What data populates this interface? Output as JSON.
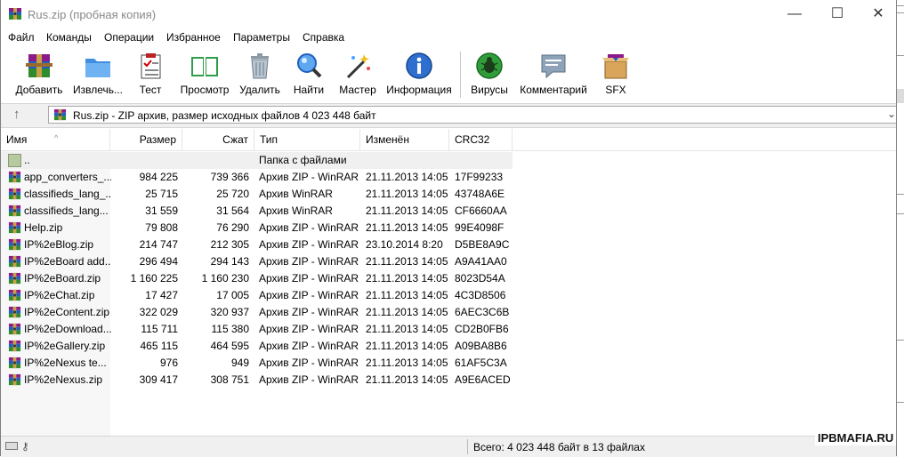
{
  "window": {
    "title": "Rus.zip (пробная копия)",
    "minimize_glyph": "—",
    "maximize_glyph": "☐",
    "close_glyph": "✕"
  },
  "menu": [
    "Файл",
    "Команды",
    "Операции",
    "Избранное",
    "Параметры",
    "Справка"
  ],
  "toolbar": [
    {
      "label": "Добавить",
      "icon": "add-archive-icon"
    },
    {
      "label": "Извлечь...",
      "icon": "extract-folder-icon"
    },
    {
      "label": "Тест",
      "icon": "test-clipboard-icon"
    },
    {
      "label": "Просмотр",
      "icon": "view-book-icon"
    },
    {
      "label": "Удалить",
      "icon": "trash-icon"
    },
    {
      "label": "Найти",
      "icon": "find-magnifier-icon"
    },
    {
      "label": "Мастер",
      "icon": "wizard-wand-icon"
    },
    {
      "label": "Информация",
      "icon": "info-icon"
    },
    {
      "label": "Вирусы",
      "icon": "virus-scan-icon"
    },
    {
      "label": "Комментарий",
      "icon": "comment-icon"
    },
    {
      "label": "SFX",
      "icon": "sfx-box-icon"
    }
  ],
  "address": {
    "up_glyph": "↑",
    "path": "Rus.zip - ZIP архив, размер исходных файлов 4 023 448 байт",
    "dropdown_glyph": "⌄"
  },
  "columns": [
    "Имя",
    "Размер",
    "Сжат",
    "Тип",
    "Изменён",
    "CRC32"
  ],
  "parent_row": {
    "name": "..",
    "type": "Папка с файлами"
  },
  "files": [
    {
      "name": "app_converters_...",
      "size": "984 225",
      "packed": "739 366",
      "type": "Архив ZIP - WinRAR",
      "modified": "21.11.2013 14:05",
      "crc": "17F99233"
    },
    {
      "name": "classifieds_lang_...",
      "size": "25 715",
      "packed": "25 720",
      "type": "Архив WinRAR",
      "modified": "21.11.2013 14:05",
      "crc": "43748A6E"
    },
    {
      "name": "classifieds_lang...",
      "size": "31 559",
      "packed": "31 564",
      "type": "Архив WinRAR",
      "modified": "21.11.2013 14:05",
      "crc": "CF6660AA"
    },
    {
      "name": "Help.zip",
      "size": "79 808",
      "packed": "76 290",
      "type": "Архив ZIP - WinRAR",
      "modified": "21.11.2013 14:05",
      "crc": "99E4098F"
    },
    {
      "name": "IP%2eBlog.zip",
      "size": "214 747",
      "packed": "212 305",
      "type": "Архив ZIP - WinRAR",
      "modified": "23.10.2014 8:20",
      "crc": "D5BE8A9C"
    },
    {
      "name": "IP%2eBoard add...",
      "size": "296 494",
      "packed": "294 143",
      "type": "Архив ZIP - WinRAR",
      "modified": "21.11.2013 14:05",
      "crc": "A9A41AA0"
    },
    {
      "name": "IP%2eBoard.zip",
      "size": "1 160 225",
      "packed": "1 160 230",
      "type": "Архив ZIP - WinRAR",
      "modified": "21.11.2013 14:05",
      "crc": "8023D54A"
    },
    {
      "name": "IP%2eChat.zip",
      "size": "17 427",
      "packed": "17 005",
      "type": "Архив ZIP - WinRAR",
      "modified": "21.11.2013 14:05",
      "crc": "4C3D8506"
    },
    {
      "name": "IP%2eContent.zip",
      "size": "322 029",
      "packed": "320 937",
      "type": "Архив ZIP - WinRAR",
      "modified": "21.11.2013 14:05",
      "crc": "6AEC3C6B"
    },
    {
      "name": "IP%2eDownload...",
      "size": "115 711",
      "packed": "115 380",
      "type": "Архив ZIP - WinRAR",
      "modified": "21.11.2013 14:05",
      "crc": "CD2B0FB6"
    },
    {
      "name": "IP%2eGallery.zip",
      "size": "465 115",
      "packed": "464 595",
      "type": "Архив ZIP - WinRAR",
      "modified": "21.11.2013 14:05",
      "crc": "A09BA8B6"
    },
    {
      "name": "IP%2eNexus te...",
      "size": "976",
      "packed": "949",
      "type": "Архив ZIP - WinRAR",
      "modified": "21.11.2013 14:05",
      "crc": "61AF5C3A"
    },
    {
      "name": "IP%2eNexus.zip",
      "size": "309 417",
      "packed": "308 751",
      "type": "Архив ZIP - WinRAR",
      "modified": "21.11.2013 14:05",
      "crc": "A9E6ACED"
    }
  ],
  "status": {
    "total": "Всего: 4 023 448 байт в 13 файлах",
    "watermark": "IPBMAFIA.RU"
  },
  "colors": {
    "accent_blue": "#1a5fb4",
    "status_bg": "#f0f0f0"
  }
}
